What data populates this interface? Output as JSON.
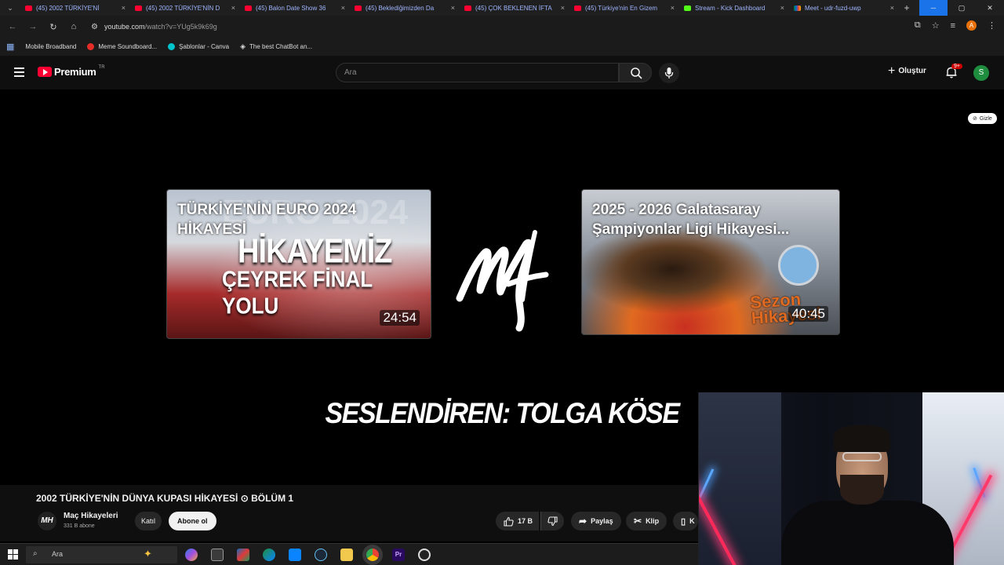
{
  "browser": {
    "tabs": [
      {
        "title": "(45) 2002 TÜRKİYE'Nİ",
        "favicon": "youtube",
        "active": true
      },
      {
        "title": "(45) 2002 TÜRKİYE'NİN D",
        "favicon": "youtube"
      },
      {
        "title": "(45) Balon Date Show 36",
        "favicon": "youtube"
      },
      {
        "title": "(45) Beklediğimizden Da",
        "favicon": "youtube"
      },
      {
        "title": "(45) ÇOK BEKLENEN İFTA",
        "favicon": "youtube"
      },
      {
        "title": "(45) Türkiye'nin En Gizem",
        "favicon": "youtube"
      },
      {
        "title": "Stream - Kick Dashboard",
        "favicon": "kick"
      },
      {
        "title": "Meet - udr-fuzd-uwp",
        "favicon": "meet"
      }
    ],
    "url_host": "youtube.com",
    "url_path": "/watch?v=YUg5k9k69g",
    "profile_initial": "A",
    "bookmarks": [
      {
        "label": "Mobile Broadband",
        "color": "#1b1b1b"
      },
      {
        "label": "Meme Soundboard...",
        "color": "#e52d27"
      },
      {
        "label": "Şablonlar - Canva",
        "color": "#00c4cc"
      },
      {
        "label": "The best ChatBot an...",
        "color": "#ffffff"
      }
    ]
  },
  "youtube": {
    "logo_text": "Premium",
    "logo_region": "TR",
    "search_placeholder": "Ara",
    "create_label": "Oluştur",
    "notif_count": "9+",
    "avatar_initial": "S"
  },
  "video": {
    "hide_label": "Gizle",
    "card1": {
      "title": "TÜRKİYE'NİN EURO 2024 HİKAYESİ",
      "overlay_ghost": "EURO 2024",
      "overlay_big": "HİKAYEMİZ",
      "overlay_mid": "ÇEYREK FİNAL YOLU",
      "duration": "24:54"
    },
    "card2": {
      "title": "2025 - 2026 Galatasaray Şampiyonlar Ligi Hikayesi...",
      "badge": "Sezon Hikayesi",
      "duration": "40:45"
    },
    "narrator": "SESLENDİREN: TOLGA KÖSE"
  },
  "details": {
    "title": "2002 TÜRKİYE'NİN DÜNYA KUPASI HİKAYESİ ⊙ BÖLÜM 1",
    "channel_name": "Maç Hikayeleri",
    "subscribers": "331 B abone",
    "join_label": "Katıl",
    "subscribe_label": "Abone ol",
    "likes": "17 B",
    "share_label": "Paylaş",
    "clip_label": "Klip",
    "save_label_partial": "K"
  },
  "taskbar": {
    "search_placeholder": "Ara"
  }
}
